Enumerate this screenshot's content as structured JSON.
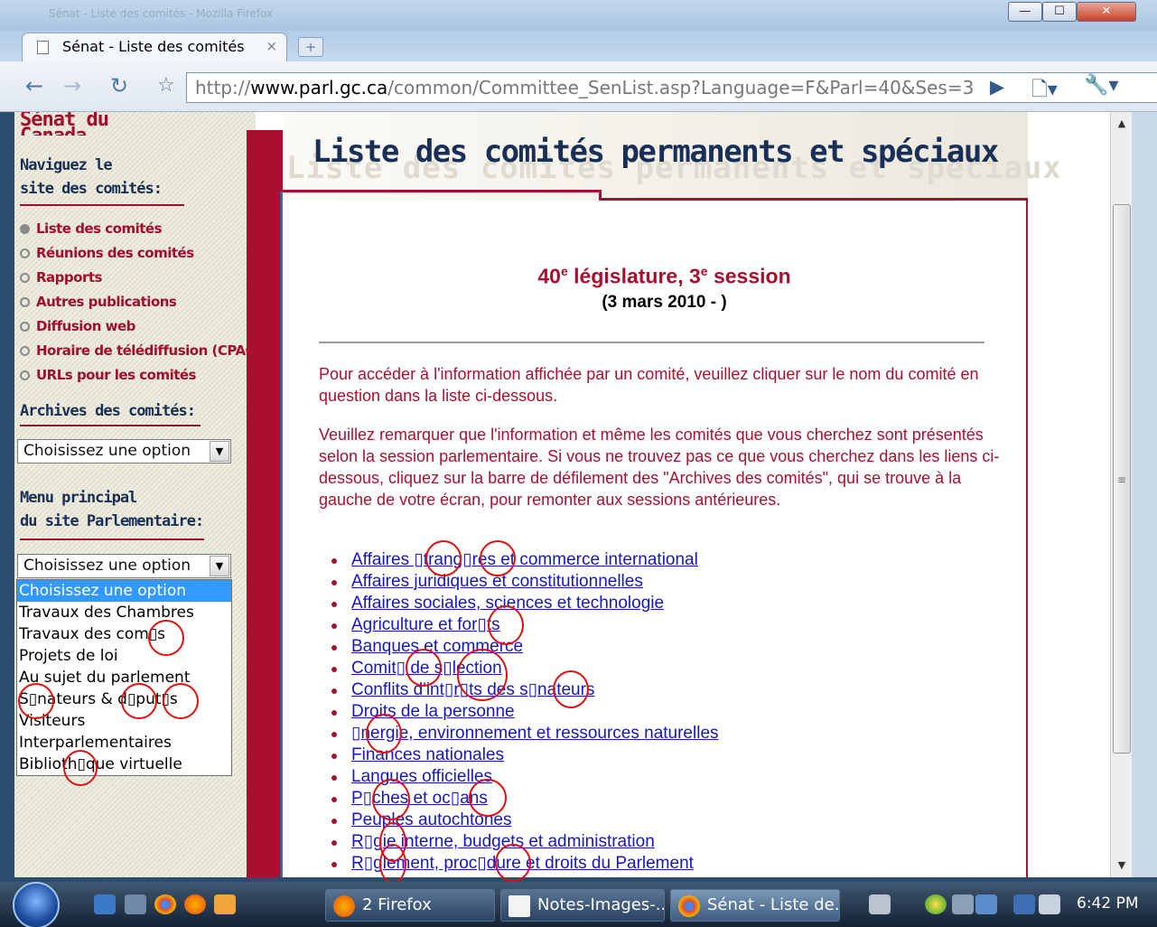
{
  "window": {
    "caption": "Sénat - Liste des comités - Mozilla Firefox",
    "minimize_glyph": "—",
    "maximize_glyph": "☐",
    "close_glyph": "✕"
  },
  "tab": {
    "title": "Sénat - Liste des comités",
    "close_glyph": "×",
    "new_tab_glyph": "+"
  },
  "toolbar": {
    "back_glyph": "←",
    "forward_glyph": "→",
    "reload_glyph": "↻",
    "star_glyph": "☆",
    "url_prefix": "http://",
    "url_host": "www.parl.gc.ca",
    "url_path": "/common/Committee_SenList.asp?Language=F&Parl=40&Ses=3",
    "go_glyph": "▶",
    "page_menu_glyph": "🗋▾",
    "wrench_glyph": "🔧▾"
  },
  "sidebar": {
    "banner": "Sénat du Canada",
    "nav_heading_line1": "Naviguez le",
    "nav_heading_line2": "site des comités:",
    "items": [
      {
        "label": "Liste des comités"
      },
      {
        "label": "Réunions des comités"
      },
      {
        "label": "Rapports"
      },
      {
        "label": "Autres publications"
      },
      {
        "label": "Diffusion web"
      },
      {
        "label": "Horaire de télédiffusion (CPAC)"
      },
      {
        "label": "URLs pour les comités"
      }
    ],
    "archives_heading": "Archives des comités:",
    "archives_select": "Choisissez une option",
    "menu_heading_line1": "Menu principal",
    "menu_heading_line2": "du site Parlementaire:",
    "menu_select": "Choisissez une option",
    "dropdown_options": [
      "Choisissez une option",
      "Travaux des Chambres",
      "Travaux des com▯s",
      "Projets de loi",
      "Au sujet du parlement",
      "S▯nateurs & d▯put▯s",
      "Visiteurs",
      "Interparlementaires",
      "Biblioth▯que virtuelle"
    ],
    "arrow_glyph": "▼"
  },
  "page": {
    "banner_title": "Liste des comités permanents et spéciaux",
    "session_num": "40",
    "session_sup1": "e",
    "session_mid": " législature, 3",
    "session_sup2": "e",
    "session_end": " session",
    "session_date": "(3 mars 2010 - )",
    "para1": "Pour accéder à l'information affichée par un comité, veuillez cliquer sur le nom du comité en question dans la liste ci-dessous.",
    "para2": "Veuillez remarquer que l'information et même les comités que vous cherchez sont présentés selon la session parlementaire. Si vous ne trouvez pas ce que vous cherchez dans les liens ci-dessous, cliquez sur la barre de défilement des \"Archives des comités\", qui se trouve à la gauche de votre écran, pour remonter aux sessions antérieures.",
    "committees": [
      "Affaires ▯trang▯res et commerce international",
      "Affaires juridiques et constitutionnelles",
      "Affaires sociales, sciences et technologie",
      "Agriculture et for▯ts",
      "Banques et commerce",
      "Comit▯ de s▯lection",
      "Conflits d'int▯r▯ts des s▯nateurs",
      "Droits de la personne",
      "▯nergie, environnement et ressources naturelles",
      "Finances nationales",
      "Langues officielles",
      "P▯ches et oc▯ans",
      "Peuples autochtones",
      "R▯gie interne, budgets et administration",
      "R▯glement, proc▯dure et droits du Parlement"
    ]
  },
  "scrollbar": {
    "up_glyph": "▲",
    "down_glyph": "▼",
    "grip_glyph": "≡"
  },
  "taskbar": {
    "firefox_group": "2 Firefox",
    "notes": "Notes-Images-...",
    "chrome_window": "Sénat - Liste de...",
    "clock": "6:42 PM"
  },
  "colors": {
    "accent_red": "#a9102f",
    "navy": "#1a2f56",
    "link_blue": "#1515c8",
    "annotation_red": "#e01010"
  }
}
